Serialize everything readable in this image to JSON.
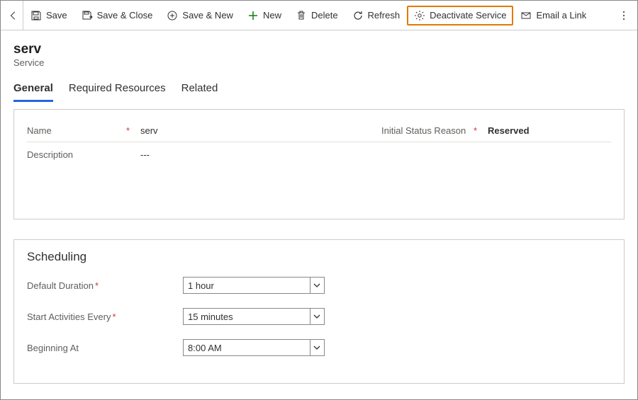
{
  "toolbar": {
    "save": "Save",
    "saveclose": "Save & Close",
    "savenew": "Save & New",
    "new": "New",
    "delete": "Delete",
    "refresh": "Refresh",
    "deactivate": "Deactivate Service",
    "emaillink": "Email a Link"
  },
  "header": {
    "title": "serv",
    "subtitle": "Service"
  },
  "tabs": {
    "general": "General",
    "reqres": "Required Resources",
    "related": "Related"
  },
  "fields": {
    "name_label": "Name",
    "name_value": "serv",
    "status_label": "Initial Status Reason",
    "status_value": "Reserved",
    "desc_label": "Description",
    "desc_value": "---"
  },
  "scheduling": {
    "heading": "Scheduling",
    "duration_label": "Default Duration",
    "duration_value": "1 hour",
    "startevery_label": "Start Activities Every",
    "startevery_value": "15 minutes",
    "begin_label": "Beginning At",
    "begin_value": "8:00 AM"
  }
}
